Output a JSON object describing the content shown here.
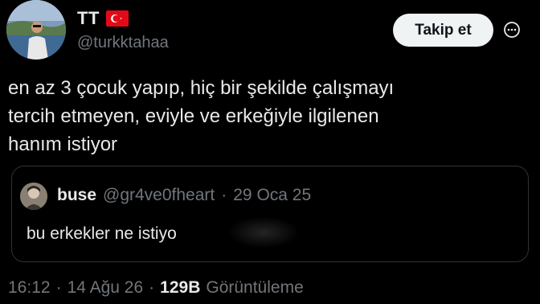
{
  "author": {
    "display_name": "TT",
    "handle": "@turkktahaa",
    "flag_icon": "turkey-flag-icon"
  },
  "actions": {
    "follow_label": "Takip et",
    "more_icon": "more-horizontal-icon"
  },
  "tweet": {
    "text": "en az 3 çocuk yapıp, hiç bir şekilde çalışmayı\ntercih etmeyen, eviyle ve erkeğiyle ilgilenen\nhanım istiyor"
  },
  "quoted_tweet": {
    "display_name": "buse",
    "handle": "@gr4ve0fheart",
    "separator": "·",
    "date": "29 Oca 25",
    "text": "bu erkekler ne istiyo"
  },
  "meta": {
    "time": "16:12",
    "sep1": "·",
    "date": "14 Ağu 26",
    "sep2": "·",
    "views_count": "129B",
    "views_label": "Görüntüleme"
  },
  "colors": {
    "background": "#000000",
    "text_primary": "#e7e9ea",
    "text_secondary": "#71767b",
    "border": "#2f3336",
    "button_bg": "#eff3f4",
    "flag_red": "#e30a17"
  }
}
